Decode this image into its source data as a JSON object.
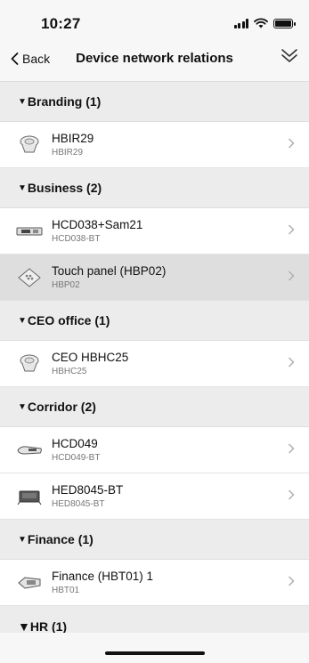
{
  "status": {
    "time": "10:27"
  },
  "nav": {
    "back_label": "Back",
    "title": "Device network relations"
  },
  "sections": [
    {
      "title": "Branding (1)",
      "items": [
        {
          "title": "HBIR29",
          "subtitle": "HBIR29",
          "icon": "round-sensor-icon"
        }
      ]
    },
    {
      "title": "Business (2)",
      "items": [
        {
          "title": "HCD038+Sam21",
          "subtitle": "HCD038-BT",
          "icon": "rail-module-icon"
        },
        {
          "title": "Touch panel  (HBP02)",
          "subtitle": "HBP02",
          "icon": "keypad-icon",
          "selected": true
        }
      ]
    },
    {
      "title": "CEO office (1)",
      "items": [
        {
          "title": "CEO HBHC25",
          "subtitle": "HBHC25",
          "icon": "round-sensor-icon"
        }
      ]
    },
    {
      "title": "Corridor (2)",
      "items": [
        {
          "title": "HCD049",
          "subtitle": "HCD049-BT",
          "icon": "strip-controller-icon"
        },
        {
          "title": "HED8045-BT",
          "subtitle": "HED8045-BT",
          "icon": "driver-box-icon"
        }
      ]
    },
    {
      "title": "Finance (1)",
      "items": [
        {
          "title": "Finance (HBT01) 1",
          "subtitle": "HBT01",
          "icon": "tracker-icon"
        }
      ]
    },
    {
      "title": "HR (1)"
    }
  ]
}
